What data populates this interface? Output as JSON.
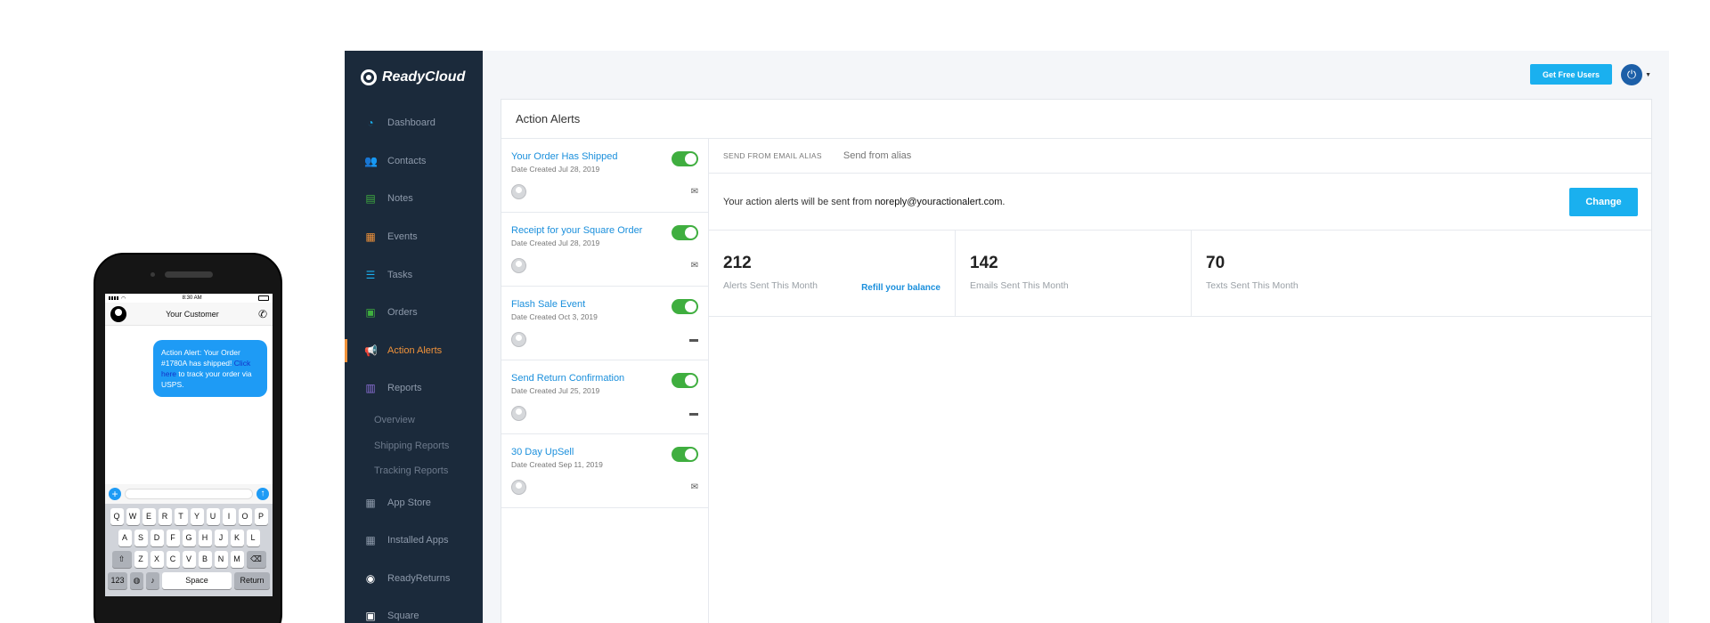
{
  "phone": {
    "time": "8:30 AM",
    "contact": "Your Customer",
    "message_prefix": "Action Alert: Your Order #1780A has shipped!",
    "message_link": "Click here",
    "message_suffix": "to track your order via USPS.",
    "keyboard": {
      "row1": [
        "Q",
        "W",
        "E",
        "R",
        "T",
        "Y",
        "U",
        "I",
        "O",
        "P"
      ],
      "row2": [
        "A",
        "S",
        "D",
        "F",
        "G",
        "H",
        "J",
        "K",
        "L"
      ],
      "row3": [
        "Z",
        "X",
        "C",
        "V",
        "B",
        "N",
        "M"
      ],
      "numbers_key": "123",
      "space_key": "Space",
      "return_key": "Return"
    }
  },
  "sidebar": {
    "brand": "ReadyCloud",
    "items": [
      {
        "label": "Dashboard",
        "icon": "dashboard-icon",
        "glyph": "◔",
        "color": "#1ab0ef"
      },
      {
        "label": "Contacts",
        "icon": "contacts-icon",
        "glyph": "👥",
        "color": "#f2c230"
      },
      {
        "label": "Notes",
        "icon": "notes-icon",
        "glyph": "▤",
        "color": "#3fae3f"
      },
      {
        "label": "Events",
        "icon": "events-icon",
        "glyph": "▦",
        "color": "#f0923a"
      },
      {
        "label": "Tasks",
        "icon": "tasks-icon",
        "glyph": "☰",
        "color": "#1ab0ef"
      },
      {
        "label": "Orders",
        "icon": "orders-icon",
        "glyph": "▣",
        "color": "#3fae3f"
      },
      {
        "label": "Action Alerts",
        "icon": "megaphone-icon",
        "glyph": "📢",
        "color": "#f0923a",
        "active": true
      },
      {
        "label": "Reports",
        "icon": "reports-icon",
        "glyph": "▥",
        "color": "#8b6fd6"
      }
    ],
    "subitems": [
      "Overview",
      "Shipping Reports",
      "Tracking Reports"
    ],
    "items_bottom": [
      {
        "label": "App Store",
        "icon": "app-store-icon",
        "glyph": "▦",
        "color": "#8e9aab"
      },
      {
        "label": "Installed Apps",
        "icon": "installed-apps-icon",
        "glyph": "▦",
        "color": "#8e9aab"
      },
      {
        "label": "ReadyReturns",
        "icon": "readyreturns-icon",
        "glyph": "◉",
        "color": "#ffffff"
      },
      {
        "label": "Square",
        "icon": "square-icon",
        "glyph": "▣",
        "color": "#ffffff"
      }
    ]
  },
  "topbar": {
    "free_users_label": "Get Free Users"
  },
  "panel": {
    "title": "Action Alerts",
    "alerts": [
      {
        "name": "Your Order Has Shipped",
        "date": "Date Created Jul 28, 2019",
        "type_icon": "email-icon",
        "glyph": "✉"
      },
      {
        "name": "Receipt for your Square Order",
        "date": "Date Created Jul 28, 2019",
        "type_icon": "email-icon",
        "glyph": "✉"
      },
      {
        "name": "Flash Sale Event",
        "date": "Date Created Oct 3, 2019",
        "type_icon": "sms-icon",
        "glyph": "▬"
      },
      {
        "name": "Send Return Confirmation",
        "date": "Date Created Jul 25, 2019",
        "type_icon": "sms-icon",
        "glyph": "▬"
      },
      {
        "name": "30 Day UpSell",
        "date": "Date Created Sep 11, 2019",
        "type_icon": "email-icon",
        "glyph": "✉"
      }
    ],
    "alias_label": "SEND FROM EMAIL ALIAS",
    "alias_placeholder": "Send from alias",
    "sent_prefix": "Your action alerts will be sent from ",
    "sent_email": "noreply@youractionalert.com",
    "sent_suffix": ".",
    "change_label": "Change",
    "stats": [
      {
        "value": "212",
        "label": "Alerts Sent This Month"
      },
      {
        "value": "142",
        "label": "Emails Sent This Month"
      },
      {
        "value": "70",
        "label": "Texts Sent This Month"
      }
    ],
    "refill_label": "Refill your balance"
  }
}
